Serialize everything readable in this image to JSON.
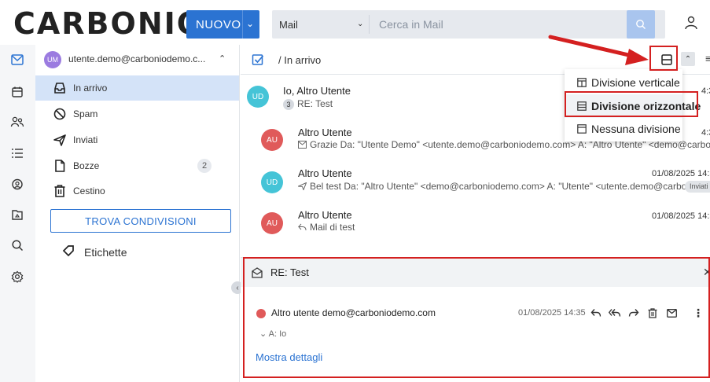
{
  "header": {
    "logo": "CARBONIO",
    "new_button": "NUOVO",
    "search_module": "Mail",
    "search_placeholder": "Cerca in Mail"
  },
  "account": {
    "initials": "UM",
    "name": "utente.demo@carboniodemo.c..."
  },
  "folders": [
    {
      "label": "In arrivo",
      "icon": "inbox-icon",
      "active": true
    },
    {
      "label": "Spam",
      "icon": "spam-icon"
    },
    {
      "label": "Inviati",
      "icon": "send-icon"
    },
    {
      "label": "Bozze",
      "icon": "draft-icon",
      "badge": "2"
    },
    {
      "label": "Cestino",
      "icon": "trash-icon"
    }
  ],
  "find_shares_button": "TROVA CONDIVISIONI",
  "tags_label": "Etichette",
  "list": {
    "path": "/ In arrivo",
    "conversations": [
      {
        "initials": "UD",
        "sender": "Io, Altro Utente",
        "count": "3",
        "subject": "RE: Test",
        "date": "4:3"
      },
      {
        "initials": "AU",
        "sender": "Altro Utente",
        "subject": "Grazie Da: \"Utente Demo\" <utente.demo@carboniodemo.com> A: \"Altro Utente\" <demo@carboniod...",
        "date": "4:3"
      },
      {
        "initials": "UD",
        "sender": "Altro Utente",
        "subject": "Bel test Da: \"Altro Utente\" <demo@carboniodemo.com> A: \"Utente\" <utente.demo@carbon...",
        "date": "01/08/2025 14:3",
        "tag": "Inviati"
      },
      {
        "initials": "AU",
        "sender": "Altro Utente",
        "subject": "Mail di test",
        "date": "01/08/2025 14:3"
      }
    ]
  },
  "layout_menu": {
    "items": [
      {
        "label": "Divisione verticale"
      },
      {
        "label": "Divisione orizzontale",
        "selected": true
      },
      {
        "label": "Nessuna divisione"
      }
    ]
  },
  "reader": {
    "title": "RE: Test",
    "from": "Altro utente  demo@carboniodemo.com",
    "date": "01/08/2025 14:35",
    "to": "A: Io",
    "show_details": "Mostra dettagli"
  },
  "colors": {
    "accent": "#2b73d2",
    "annotation": "#d42020",
    "avatar_ud": "#45c4d7",
    "avatar_au": "#e05a5a"
  }
}
